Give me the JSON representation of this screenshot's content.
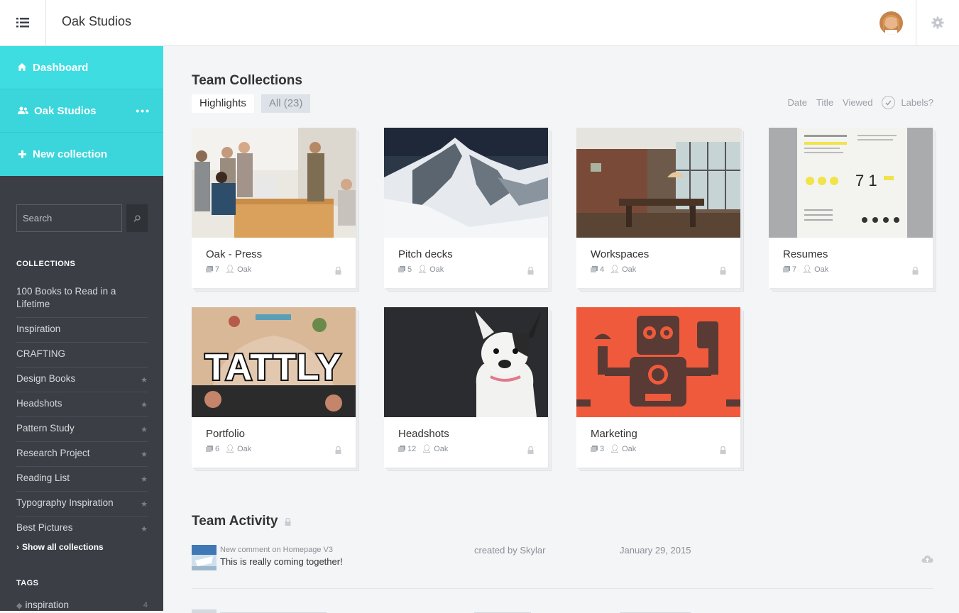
{
  "header": {
    "app_title": "Oak Studios"
  },
  "sidebar": {
    "nav": [
      {
        "label": "Dashboard",
        "icon": "home-icon"
      },
      {
        "label": "Oak Studios",
        "icon": "team-icon"
      },
      {
        "label": "New collection",
        "icon": "plus-icon"
      }
    ],
    "more_label": "•••",
    "search_placeholder": "Search",
    "collections_heading": "COLLECTIONS",
    "collections": [
      {
        "label": "100 Books to Read in a Lifetime",
        "starred": false
      },
      {
        "label": "Inspiration",
        "starred": false
      },
      {
        "label": "CRAFTING",
        "starred": false
      },
      {
        "label": "Design Books",
        "starred": true
      },
      {
        "label": "Headshots",
        "starred": true
      },
      {
        "label": "Pattern Study",
        "starred": true
      },
      {
        "label": "Research Project",
        "starred": true
      },
      {
        "label": "Reading List",
        "starred": true
      },
      {
        "label": "Typography Inspiration",
        "starred": true
      },
      {
        "label": "Best Pictures",
        "starred": true
      }
    ],
    "show_all_label": "Show all collections",
    "tags_heading": "TAGS",
    "tags": [
      {
        "label": "inspiration",
        "count": "4"
      }
    ]
  },
  "main": {
    "collections_title": "Team Collections",
    "tabs": [
      {
        "label": "Highlights"
      },
      {
        "label": "All (23)"
      }
    ],
    "sort_options": [
      "Date",
      "Title",
      "Viewed"
    ],
    "labels_toggle": "Labels?",
    "cards": [
      {
        "name": "Oak - Press",
        "count": "7",
        "owner": "Oak"
      },
      {
        "name": "Pitch decks",
        "count": "5",
        "owner": "Oak"
      },
      {
        "name": "Workspaces",
        "count": "4",
        "owner": "Oak"
      },
      {
        "name": "Resumes",
        "count": "7",
        "owner": "Oak"
      },
      {
        "name": "Portfolio",
        "count": "6",
        "owner": "Oak"
      },
      {
        "name": "Headshots",
        "count": "12",
        "owner": "Oak"
      },
      {
        "name": "Marketing",
        "count": "3",
        "owner": "Oak"
      }
    ],
    "tattly_word": "TATTLY",
    "resume_digits": "7 1",
    "activity_title": "Team Activity",
    "activity": [
      {
        "title": "New comment on Homepage V3",
        "text": "This is really coming together!",
        "by": "created by Skylar",
        "date": "January 29, 2015"
      }
    ]
  },
  "colors": {
    "accent": "#3ad6db",
    "sidebar_bg": "#3b3e45",
    "page_bg": "#f4f5f7",
    "marketing_red": "#f05a3c"
  }
}
